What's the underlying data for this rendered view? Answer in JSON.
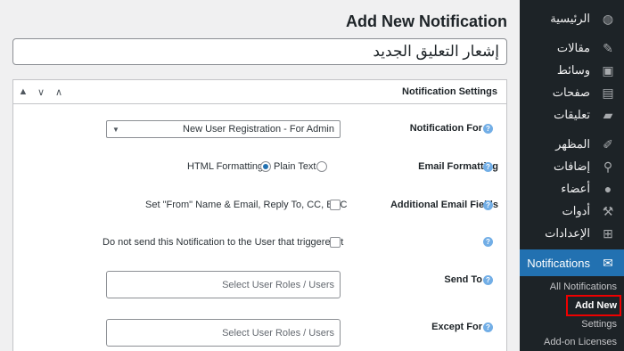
{
  "page": {
    "title": "Add New Notification",
    "notification_title_value": "إشعار التعليق الجديد"
  },
  "metabox": {
    "title": "Notification Settings",
    "controls": [
      "▲",
      "∨",
      "∧"
    ]
  },
  "fields": {
    "notification_for": {
      "label": "Notification For",
      "selected": "New User Registration - For Admin"
    },
    "email_formatting": {
      "label": "Email Formatting",
      "option_html": "HTML Formatting",
      "option_plain": "Plain Text",
      "selected": "Plain Text"
    },
    "additional_email_fields": {
      "label": "Additional Email Fields",
      "checkbox_label": "Set \"From\" Name & Email, Reply To, CC, BCC"
    },
    "do_not_send": {
      "checkbox_label": "Do not send this Notification to the User that triggered it"
    },
    "send_to": {
      "label": "Send To",
      "placeholder": "Select User Roles / Users"
    },
    "except_for": {
      "label": "Except For",
      "placeholder": "Select User Roles / Users"
    }
  },
  "sidebar": {
    "items": [
      {
        "label": "الرئيسية",
        "icon": "dashboard-icon",
        "glyph": "◍"
      },
      {
        "label": "مقالات",
        "icon": "pin-icon",
        "glyph": "✎"
      },
      {
        "label": "وسائط",
        "icon": "media-icon",
        "glyph": "▣"
      },
      {
        "label": "صفحات",
        "icon": "pages-icon",
        "glyph": "▤"
      },
      {
        "label": "تعليقات",
        "icon": "comments-icon",
        "glyph": "▰"
      },
      {
        "label": "المظهر",
        "icon": "appearance-icon",
        "glyph": "✐"
      },
      {
        "label": "إضافات",
        "icon": "plugins-icon",
        "glyph": "⚲"
      },
      {
        "label": "أعضاء",
        "icon": "users-icon",
        "glyph": "●"
      },
      {
        "label": "أدوات",
        "icon": "tools-icon",
        "glyph": "⚒"
      },
      {
        "label": "الإعدادات",
        "icon": "settings-icon",
        "glyph": "⊞"
      }
    ],
    "active_item": {
      "label": "Notifications",
      "icon": "envelope-icon",
      "glyph": "✉"
    },
    "submenu": [
      "All Notifications",
      "Add New",
      "Settings",
      "Add-on Licenses"
    ],
    "current_submenu": "Add New"
  },
  "colors": {
    "sidebar_bg": "#1d2327",
    "active_bg": "#2271b1",
    "highlight_border": "#ee0000",
    "help_icon": "#72aee6"
  }
}
